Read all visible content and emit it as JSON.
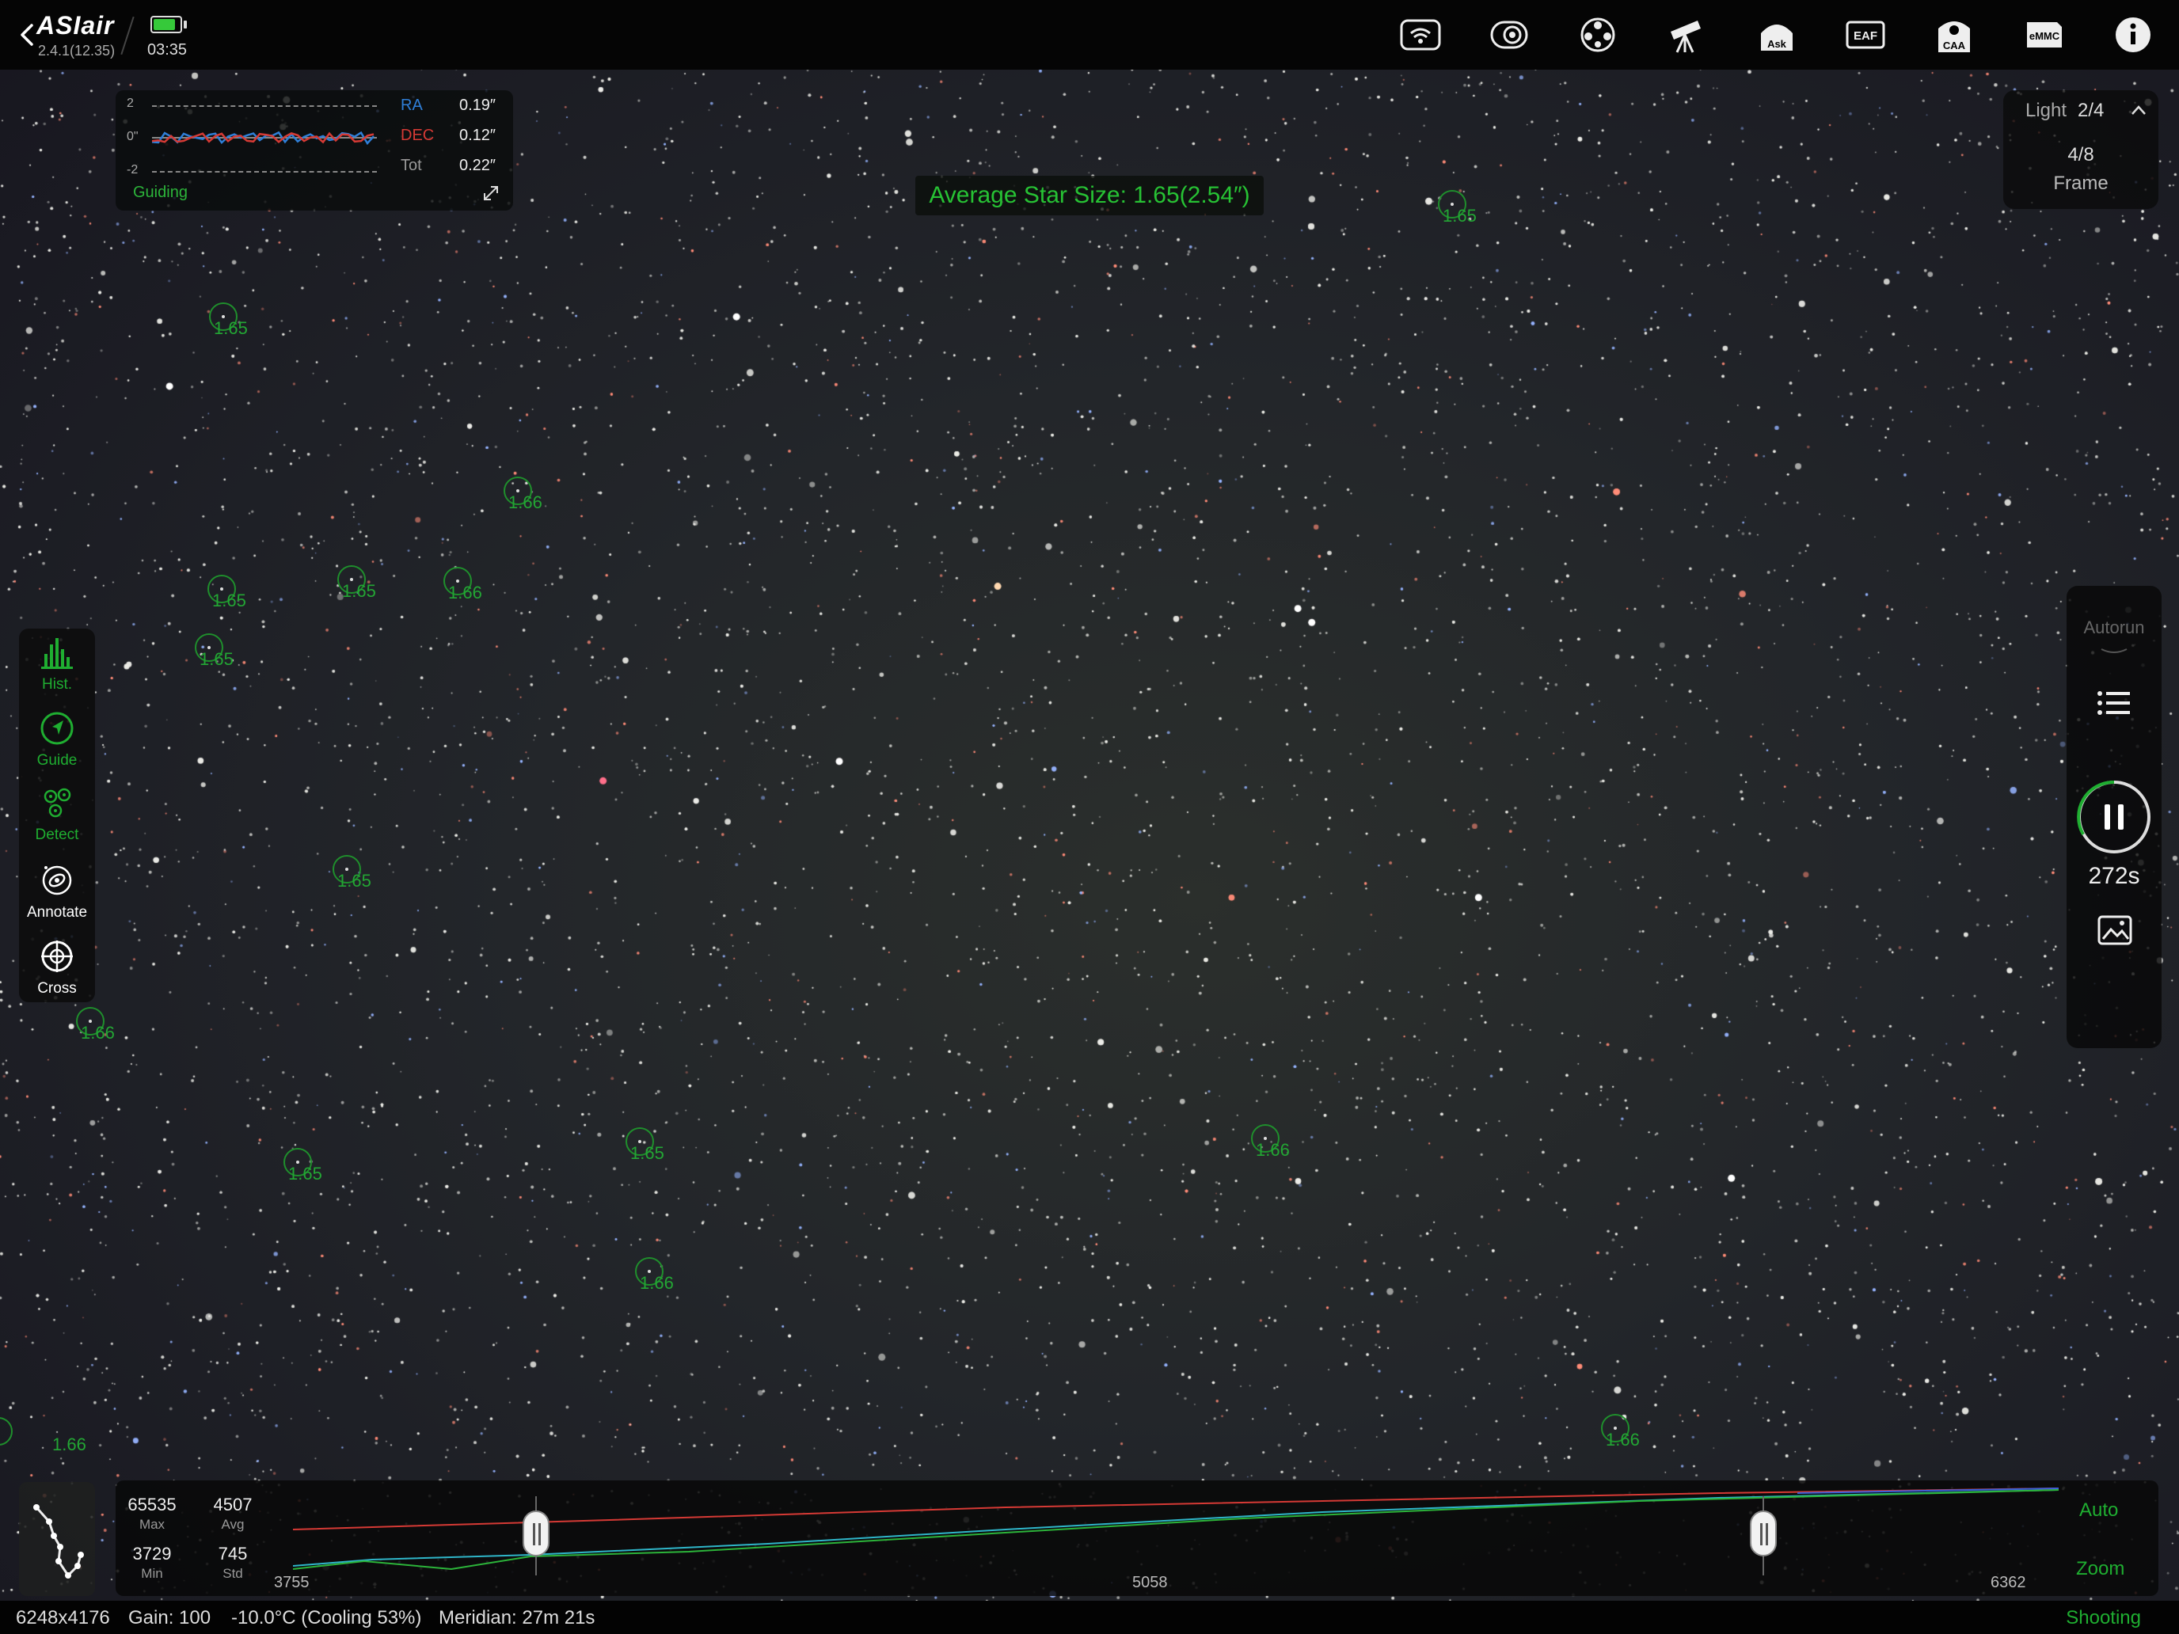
{
  "app": {
    "logo": "ASIair",
    "version": "2.4.1(12.35)",
    "clock": "03:35",
    "battery_level": 0.85
  },
  "top_icons": [
    {
      "name": "wifi-icon"
    },
    {
      "name": "camera-icon"
    },
    {
      "name": "filter-wheel-icon"
    },
    {
      "name": "telescope-mount-icon"
    },
    {
      "name": "ask-icon",
      "text": "Ask"
    },
    {
      "name": "eaf-icon",
      "text": "EAF"
    },
    {
      "name": "caa-icon",
      "text": "CAA"
    },
    {
      "name": "emmc-icon",
      "text": "eMMC"
    },
    {
      "name": "info-icon"
    }
  ],
  "guiding": {
    "axis_top": "2",
    "axis_mid": "0\"",
    "axis_bot": "-2",
    "ra_label": "RA",
    "ra_value": "0.19″",
    "dec_label": "DEC",
    "dec_value": "0.12″",
    "tot_label": "Tot",
    "tot_value": "0.22″",
    "status": "Guiding",
    "ra_color": "#2f7fd8",
    "dec_color": "#d63a35"
  },
  "average_star_size": "Average Star Size: 1.65(2.54″)",
  "star_markers": [
    {
      "value": "1.65"
    },
    {
      "value": "1.65"
    },
    {
      "value": "1.66"
    },
    {
      "value": "1.65"
    },
    {
      "value": "1.65"
    },
    {
      "value": "1.66"
    },
    {
      "value": "1.65"
    },
    {
      "value": "1.65"
    },
    {
      "value": "1.66"
    },
    {
      "value": "1.65"
    },
    {
      "value": "1.65"
    },
    {
      "value": "1.66"
    },
    {
      "value": "1.66"
    },
    {
      "value": "1.66"
    },
    {
      "value": "1.66"
    }
  ],
  "frame_panel": {
    "type": "Light",
    "sequence": "2/4",
    "frames": "4/8",
    "frame_label": "Frame"
  },
  "left_toolbar": [
    {
      "label": "Hist.",
      "color": "#1fae31"
    },
    {
      "label": "Guide",
      "color": "#1fae31"
    },
    {
      "label": "Detect",
      "color": "#1fae31"
    },
    {
      "label": "Annotate",
      "color": "#ffffff"
    },
    {
      "label": "Cross",
      "color": "#ffffff"
    }
  ],
  "right_panel": {
    "autorun": "Autorun",
    "countdown": "272s"
  },
  "histogram": {
    "max_value": "65535",
    "max_label": "Max",
    "avg_value": "4507",
    "avg_label": "Avg",
    "min_value": "3729",
    "min_label": "Min",
    "std_value": "745",
    "std_label": "Std",
    "tick_left": "3755",
    "tick_mid": "5058",
    "tick_right": "6362",
    "auto_label": "Auto",
    "zoom_label": "Zoom"
  },
  "status_bar": {
    "resolution": "6248x4176",
    "gain": "Gain: 100",
    "temperature": "-10.0°C (Cooling 53%)",
    "meridian": "Meridian: 27m 21s",
    "state": "Shooting"
  }
}
